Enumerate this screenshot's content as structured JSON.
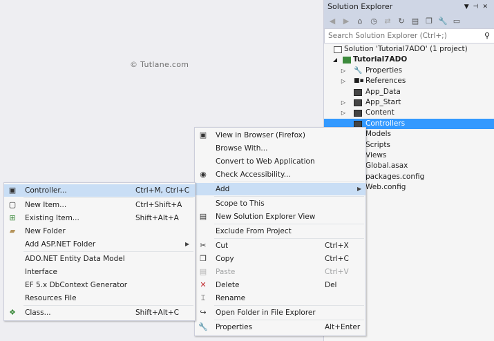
{
  "watermark": "© Tutlane.com",
  "solution_explorer": {
    "title": "Solution Explorer",
    "search_placeholder": "Search Solution Explorer (Ctrl+;)",
    "tree": [
      {
        "label": "Solution 'Tutorial7ADO' (1 project)",
        "icon": "solution-icon"
      },
      {
        "label": "Tutorial7ADO",
        "icon": "web-project-icon"
      },
      {
        "label": "Properties",
        "icon": "wrench-icon"
      },
      {
        "label": "References",
        "icon": "references-icon"
      },
      {
        "label": "App_Data",
        "icon": "folder-icon"
      },
      {
        "label": "App_Start",
        "icon": "folder-icon"
      },
      {
        "label": "Content",
        "icon": "folder-icon"
      },
      {
        "label": "Controllers",
        "icon": "folder-icon"
      },
      {
        "label": "Models",
        "icon": "folder-icon"
      },
      {
        "label": "Scripts",
        "icon": "folder-icon"
      },
      {
        "label": "Views",
        "icon": "folder-icon"
      },
      {
        "label": "Global.asax",
        "icon": "file-icon"
      },
      {
        "label": "packages.config",
        "icon": "file-icon"
      },
      {
        "label": "Web.config",
        "icon": "file-icon"
      }
    ]
  },
  "main_menu": {
    "items": [
      {
        "label": "View in Browser (Firefox)",
        "shortcut": ""
      },
      {
        "label": "Browse With...",
        "shortcut": ""
      },
      {
        "label": "Convert to Web Application",
        "shortcut": ""
      },
      {
        "label": "Check Accessibility...",
        "shortcut": ""
      },
      {
        "label": "Add",
        "shortcut": ""
      },
      {
        "label": "Scope to This",
        "shortcut": ""
      },
      {
        "label": "New Solution Explorer View",
        "shortcut": ""
      },
      {
        "label": "Exclude From Project",
        "shortcut": ""
      },
      {
        "label": "Cut",
        "shortcut": "Ctrl+X"
      },
      {
        "label": "Copy",
        "shortcut": "Ctrl+C"
      },
      {
        "label": "Paste",
        "shortcut": "Ctrl+V"
      },
      {
        "label": "Delete",
        "shortcut": "Del"
      },
      {
        "label": "Rename",
        "shortcut": ""
      },
      {
        "label": "Open Folder in File Explorer",
        "shortcut": ""
      },
      {
        "label": "Properties",
        "shortcut": "Alt+Enter"
      }
    ]
  },
  "add_submenu": {
    "items": [
      {
        "label": "Controller...",
        "shortcut": "Ctrl+M, Ctrl+C"
      },
      {
        "label": "New Item...",
        "shortcut": "Ctrl+Shift+A"
      },
      {
        "label": "Existing Item...",
        "shortcut": "Shift+Alt+A"
      },
      {
        "label": "New Folder",
        "shortcut": ""
      },
      {
        "label": "Add ASP.NET Folder",
        "shortcut": ""
      },
      {
        "label": "ADO.NET Entity Data Model",
        "shortcut": ""
      },
      {
        "label": "Interface",
        "shortcut": ""
      },
      {
        "label": "EF 5.x DbContext Generator",
        "shortcut": ""
      },
      {
        "label": "Resources File",
        "shortcut": ""
      },
      {
        "label": "Class...",
        "shortcut": "Shift+Alt+C"
      }
    ]
  }
}
